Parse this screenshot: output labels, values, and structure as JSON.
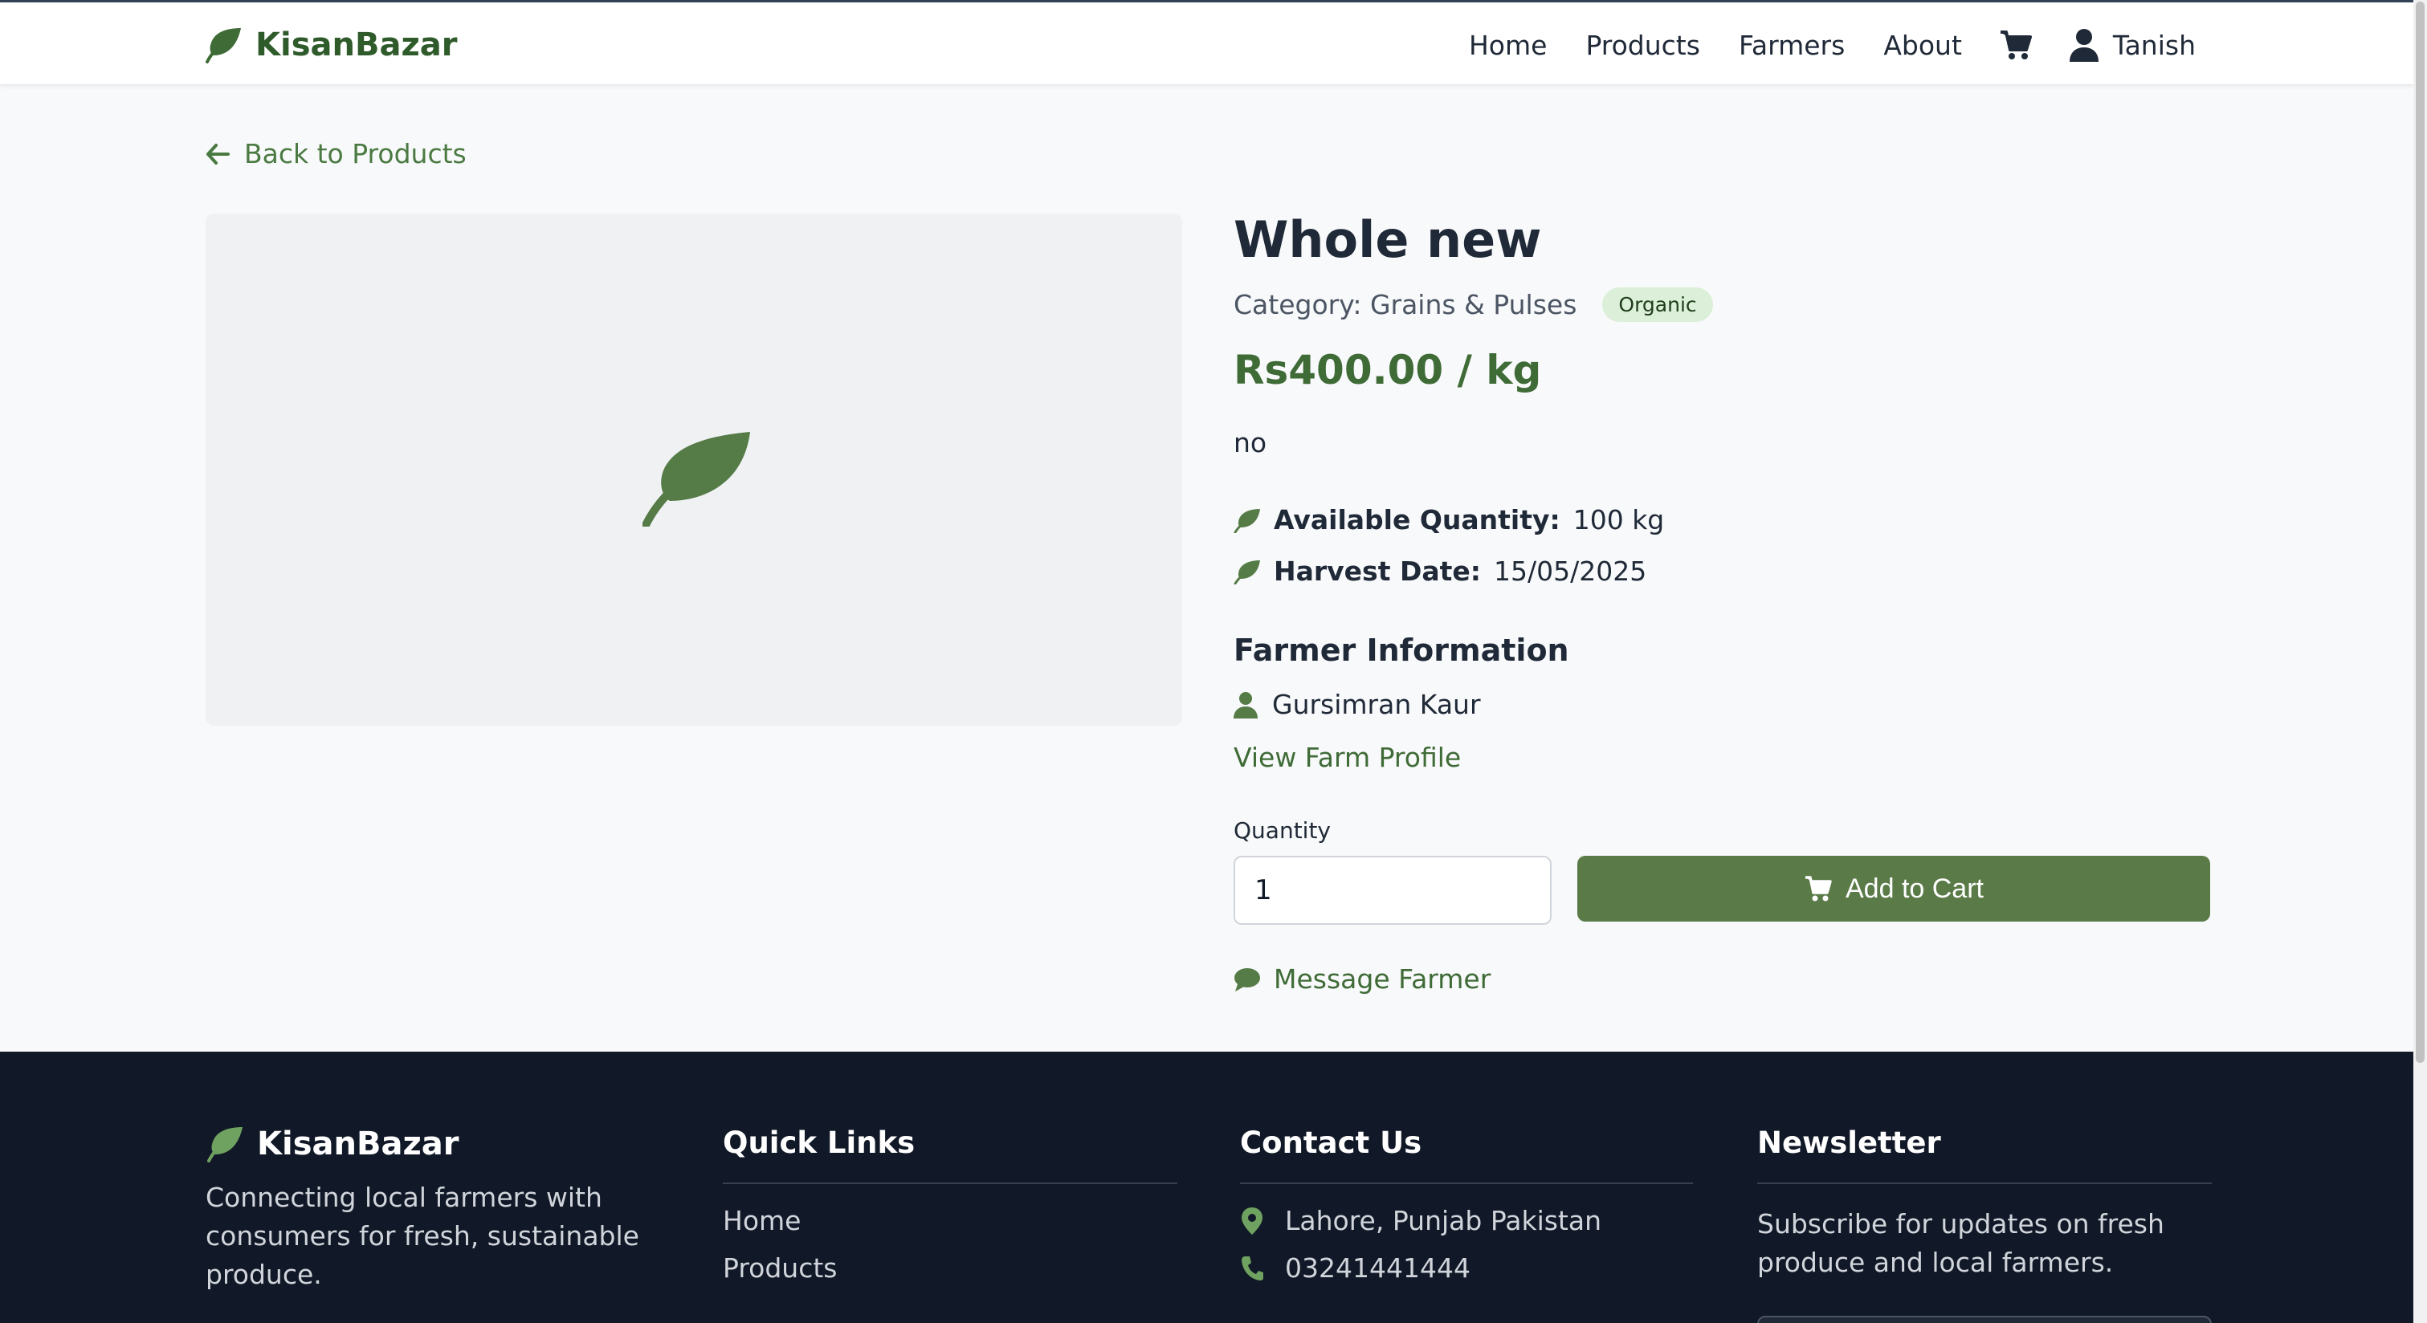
{
  "header": {
    "brand": "KisanBazar",
    "nav": [
      "Home",
      "Products",
      "Farmers",
      "About"
    ],
    "user_name": "Tanish"
  },
  "back_link": "Back to Products",
  "product": {
    "title": "Whole new",
    "category": "Category: Grains & Pulses",
    "badge": "Organic",
    "price": "Rs400.00 / kg",
    "description": "no",
    "available_label": "Available Quantity:",
    "available_value": "100 kg",
    "harvest_label": "Harvest Date:",
    "harvest_value": "15/05/2025"
  },
  "farmer": {
    "section_title": "Farmer Information",
    "name": "Gursimran Kaur",
    "profile_link": "View Farm Profile"
  },
  "purchase": {
    "quantity_label": "Quantity",
    "quantity_value": "1",
    "add_to_cart": "Add to Cart",
    "message_farmer": "Message Farmer"
  },
  "footer": {
    "brand": "KisanBazar",
    "description": "Connecting local farmers with consumers for fresh, sustainable produce.",
    "quick_links_title": "Quick Links",
    "quick_links": [
      "Home",
      "Products"
    ],
    "contact_title": "Contact Us",
    "address": "Lahore, Punjab Pakistan",
    "phone": "03241441444",
    "newsletter_title": "Newsletter",
    "newsletter_text": "Subscribe for updates on fresh produce and local farmers."
  },
  "colors": {
    "brand_green": "#2f5a2a",
    "accent_green": "#5a7b48",
    "footer_bg": "#111827",
    "badge_bg": "#dcefd9"
  },
  "icons": [
    "leaf-icon",
    "cart-icon",
    "user-icon",
    "arrow-left-icon",
    "comment-icon",
    "map-pin-icon",
    "phone-icon"
  ]
}
